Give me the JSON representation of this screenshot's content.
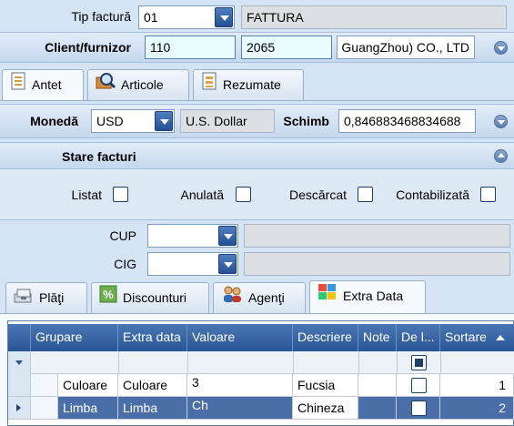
{
  "header": {
    "tip_factura_label": "Tip factură",
    "tip_factura_value": "01",
    "tip_factura_desc": "FATTURA",
    "client_label": "Client/furnizor",
    "client_code": "110",
    "client_id": "2065",
    "client_name": "GuangZhou) CO., LTD"
  },
  "tabs_top": [
    {
      "label": "Antet",
      "icon": "document-icon"
    },
    {
      "label": "Articole",
      "icon": "magnifier-box-icon"
    },
    {
      "label": "Rezumate",
      "icon": "summary-document-icon"
    }
  ],
  "currency": {
    "label": "Monedă",
    "code": "USD",
    "name": "U.S. Dollar",
    "rate_label": "Schimb",
    "rate_value": "0,846883468834688"
  },
  "stare": {
    "title": "Stare facturi",
    "listat": "Listat",
    "anulata": "Anulată",
    "descarcat": "Descărcat",
    "contabilizata": "Contabilizată"
  },
  "cup_label": "CUP",
  "cig_label": "CIG",
  "tabs_bottom": [
    {
      "label": "Plăţi",
      "icon": "payments-icon"
    },
    {
      "label": "Discounturi",
      "icon": "percent-icon"
    },
    {
      "label": "Agenţi",
      "icon": "agents-icon"
    },
    {
      "label": "Extra Data",
      "icon": "extra-data-icon"
    }
  ],
  "grid": {
    "columns": [
      "Grupare",
      "Extra data",
      "Valoare",
      "Descriere",
      "Note",
      "De l...",
      "Sortare"
    ],
    "rows": [
      {
        "grupare": "Culoare",
        "extra": "Culoare",
        "valoare": "3",
        "descriere": "Fucsia",
        "sortare": "1"
      },
      {
        "grupare": "Limba",
        "extra": "Limba",
        "valoare": "Ch",
        "descriere": "Chineza",
        "sortare": "2"
      }
    ]
  },
  "colors": {
    "accent": "#2a5596",
    "selected_row": "#4a6fa8"
  }
}
